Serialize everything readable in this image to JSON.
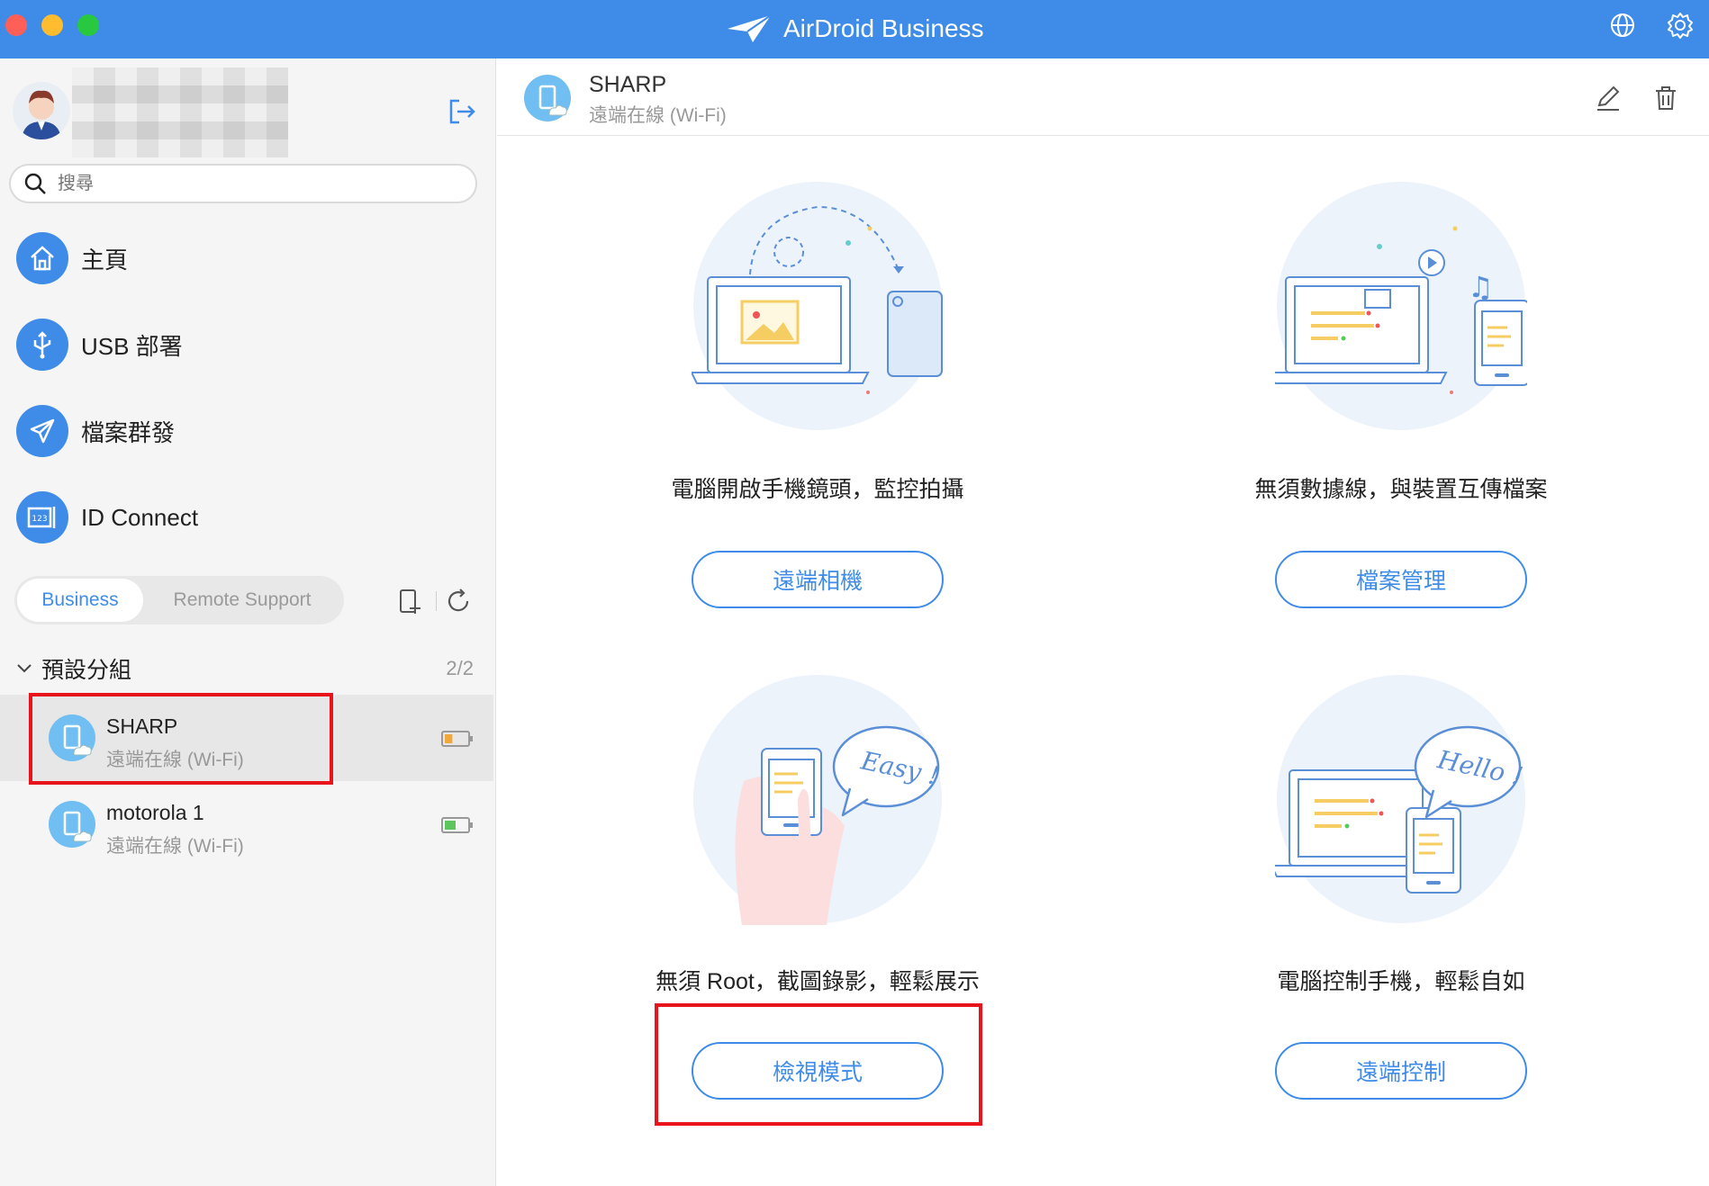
{
  "app": {
    "title": "AirDroid Business"
  },
  "colors": {
    "accent": "#3f8ce8",
    "highlight": "#e8141c",
    "device_icon": "#71bff2"
  },
  "sidebar": {
    "search_placeholder": "搜尋",
    "nav": [
      {
        "label": "主頁",
        "icon": "home-icon"
      },
      {
        "label": "USB 部署",
        "icon": "usb-icon"
      },
      {
        "label": "檔案群發",
        "icon": "send-icon"
      },
      {
        "label": "ID Connect",
        "icon": "id-connect-icon"
      }
    ],
    "tabs": {
      "active": "Business",
      "inactive": "Remote Support"
    },
    "group": {
      "name": "預設分組",
      "count": "2/2"
    },
    "devices": [
      {
        "name": "SHARP",
        "status": "遠端在線 (Wi-Fi)",
        "battery_level": 0.35,
        "battery_color": "#f0a73c"
      },
      {
        "name": "motorola 1",
        "status": "遠端在線 (Wi-Fi)",
        "battery_level": 0.5,
        "battery_color": "#5ec55e"
      }
    ]
  },
  "main": {
    "device_name": "SHARP",
    "device_status": "遠端在線 (Wi-Fi)",
    "cards": [
      {
        "caption": "電腦開啟手機鏡頭，監控拍攝",
        "button": "遠端相機"
      },
      {
        "caption": "無須數據線，與裝置互傳檔案",
        "button": "檔案管理"
      },
      {
        "caption": "無須 Root，截圖錄影，輕鬆展示",
        "button": "檢視模式",
        "bubble": "Easy !"
      },
      {
        "caption": "電腦控制手機，輕鬆自如",
        "button": "遠端控制",
        "bubble": "Hello !"
      }
    ]
  }
}
